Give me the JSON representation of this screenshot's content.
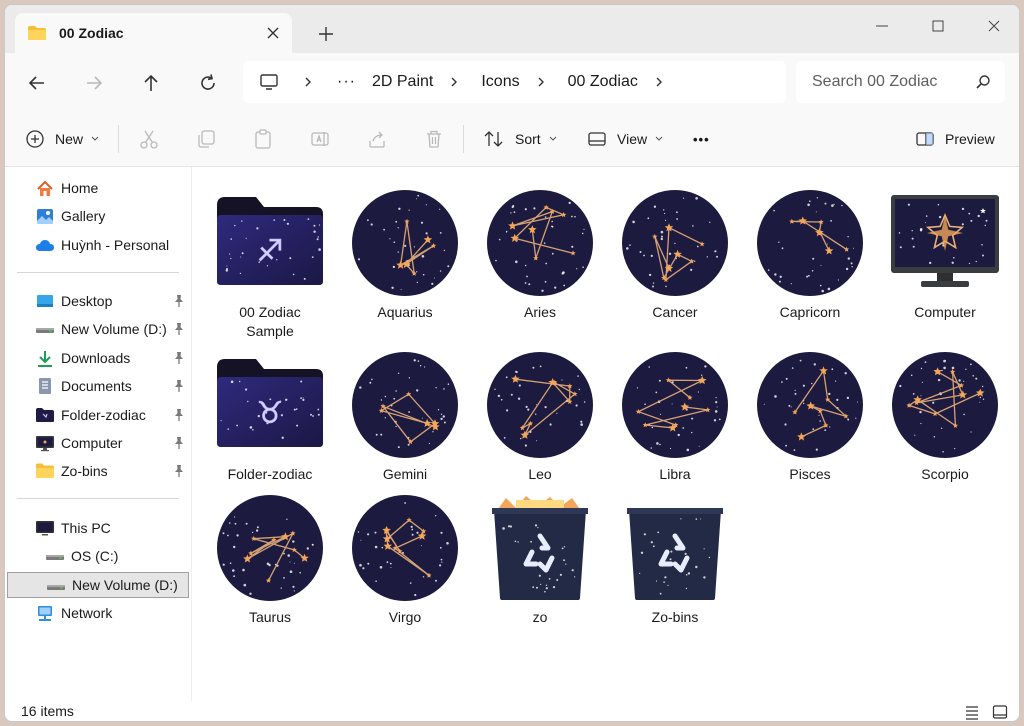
{
  "window": {
    "tab_title": "00 Zodiac"
  },
  "address": {
    "crumbs": [
      "2D Paint",
      "Icons",
      "00 Zodiac"
    ],
    "ellipsis": "···"
  },
  "search": {
    "placeholder": "Search 00 Zodiac"
  },
  "toolbar": {
    "new_label": "New",
    "sort_label": "Sort",
    "view_label": "View",
    "more_label": "•••",
    "preview_label": "Preview"
  },
  "sidebar": {
    "top": [
      {
        "label": "Home",
        "icon": "home-icon"
      },
      {
        "label": "Gallery",
        "icon": "gallery-icon"
      },
      {
        "label": "Huỳnh - Personal",
        "icon": "cloud-icon"
      }
    ],
    "quick": [
      {
        "label": "Desktop",
        "icon": "desktop-icon"
      },
      {
        "label": "New Volume (D:)",
        "icon": "drive-icon"
      },
      {
        "label": "Downloads",
        "icon": "download-icon"
      },
      {
        "label": "Documents",
        "icon": "documents-icon"
      },
      {
        "label": "Folder-zodiac",
        "icon": "folder-zodiac-icon"
      },
      {
        "label": "Computer",
        "icon": "computer-icon"
      },
      {
        "label": "Zo-bins",
        "icon": "folder-icon"
      }
    ],
    "pc": [
      {
        "label": "This PC",
        "icon": "pc-icon"
      },
      {
        "label": "OS (C:)",
        "icon": "drive-icon"
      },
      {
        "label": "New Volume (D:)",
        "icon": "drive-icon"
      },
      {
        "label": "Network",
        "icon": "network-icon"
      }
    ]
  },
  "items": [
    {
      "name": "00 Zodiac Sample",
      "kind": "folder",
      "glyph": "♐"
    },
    {
      "name": "Aquarius",
      "kind": "constellation"
    },
    {
      "name": "Aries",
      "kind": "constellation"
    },
    {
      "name": "Cancer",
      "kind": "constellation"
    },
    {
      "name": "Capricorn",
      "kind": "constellation"
    },
    {
      "name": "Computer",
      "kind": "computer"
    },
    {
      "name": "Folder-zodiac",
      "kind": "folder",
      "glyph": "♉"
    },
    {
      "name": "Gemini",
      "kind": "constellation"
    },
    {
      "name": "Leo",
      "kind": "constellation"
    },
    {
      "name": "Libra",
      "kind": "constellation"
    },
    {
      "name": "Pisces",
      "kind": "constellation"
    },
    {
      "name": "Scorpio",
      "kind": "constellation"
    },
    {
      "name": "Taurus",
      "kind": "constellation"
    },
    {
      "name": "Virgo",
      "kind": "constellation"
    },
    {
      "name": "zo",
      "kind": "bin-full"
    },
    {
      "name": "Zo-bins",
      "kind": "bin-empty"
    }
  ],
  "status": {
    "count_text": "16 items"
  },
  "colors": {
    "night": "#1c1a3f",
    "star": "#f3a55a",
    "line": "#e9b07a",
    "folder_tab": "#151226"
  }
}
